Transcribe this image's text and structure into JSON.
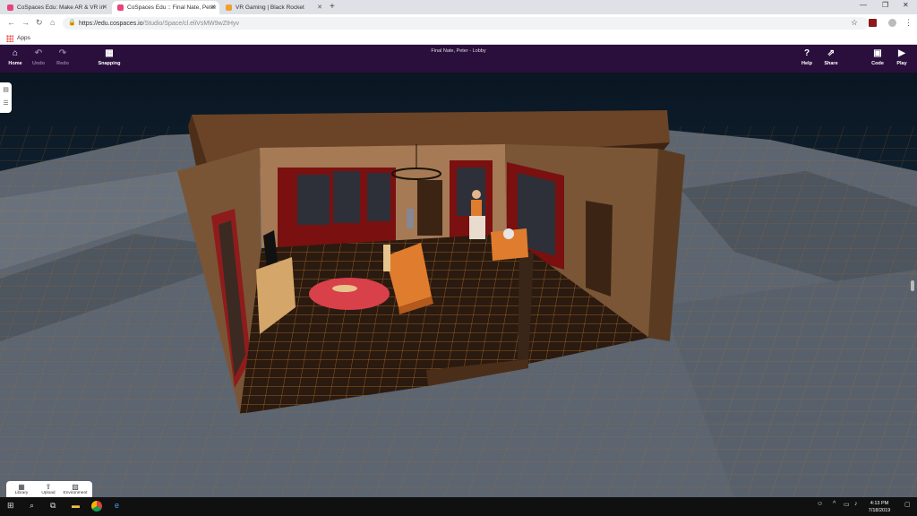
{
  "browser": {
    "tabs": [
      {
        "title": "CoSpaces Edu: Make AR & VR in",
        "color": "#e8437a"
      },
      {
        "title": "CoSpaces Edu :: Final Nate, Peter",
        "color": "#e8437a"
      },
      {
        "title": "VR Gaming | Black Rocket",
        "color": "#f0a030"
      }
    ],
    "url_host": "https://edu.cospaces.io",
    "url_path": "/Studio/Space/cl.eliVsMW9wZtHyv",
    "bookmark_apps": "Apps"
  },
  "app": {
    "title": "Final Nate, Peter - Lobby",
    "home": "Home",
    "undo": "Undo",
    "redo": "Redo",
    "snapping": "Snapping",
    "help": "Help",
    "share": "Share",
    "code": "Code",
    "play": "Play"
  },
  "bottom_panel": {
    "library": "Library",
    "upload": "Upload",
    "environment": "Environment"
  },
  "taskbar": {
    "time": "4:13 PM",
    "date": "7/18/2019"
  }
}
